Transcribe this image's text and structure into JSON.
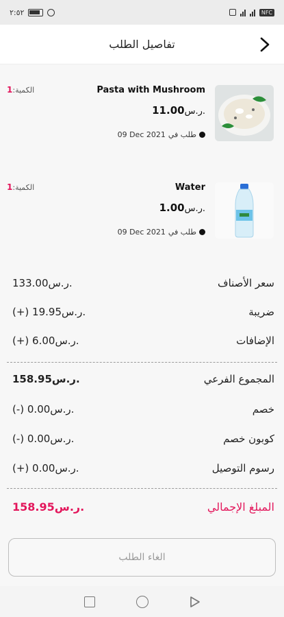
{
  "status_bar": {
    "time": "٢:٥٢",
    "battery_icon": "battery-icon",
    "alarm_icon": "alarm-icon",
    "nfc_label": "NFC"
  },
  "header": {
    "title": "تفاصيل الطلب",
    "back_icon": "chevron-right-icon"
  },
  "items": [
    {
      "name": "Pasta with Mushroom",
      "price": "11.00",
      "currency": "ر.س.",
      "date_prefix": "طلب في",
      "date": "09 Dec 2021",
      "qty_label": "الكمية:",
      "qty": "1",
      "image": "pasta-bowl-image"
    },
    {
      "name": "Water",
      "price": "1.00",
      "currency": "ر.س.",
      "date_prefix": "طلب في",
      "date": "09 Dec 2021",
      "qty_label": "الكمية:",
      "qty": "1",
      "image": "water-bottle-image"
    }
  ],
  "summary": {
    "items_price_label": "سعر الأصناف",
    "items_price_value": "133.00ر.س.",
    "tax_label": "ضريبة",
    "tax_value": "(+) 19.95ر.س.",
    "addons_label": "الإضافات",
    "addons_value": "(+) 6.00ر.س.",
    "subtotal_label": "المجموع الفرعي",
    "subtotal_value": "158.95ر.س.",
    "discount_label": "خصم",
    "discount_value": "(-) 0.00ر.س.",
    "coupon_label": "كوبون خصم",
    "coupon_value": "(-) 0.00ر.س.",
    "delivery_label": "رسوم التوصيل",
    "delivery_value": "(+) 0.00ر.س.",
    "total_label": "المبلغ الإجمالي",
    "total_value": "158.95ر.س."
  },
  "cancel_button": "الغاء الطلب",
  "colors": {
    "accent": "#e3165b",
    "background": "#f7f7f7"
  },
  "nav_bar": {
    "recent_icon": "square-icon",
    "home_icon": "circle-icon",
    "back_icon": "triangle-back-icon"
  }
}
